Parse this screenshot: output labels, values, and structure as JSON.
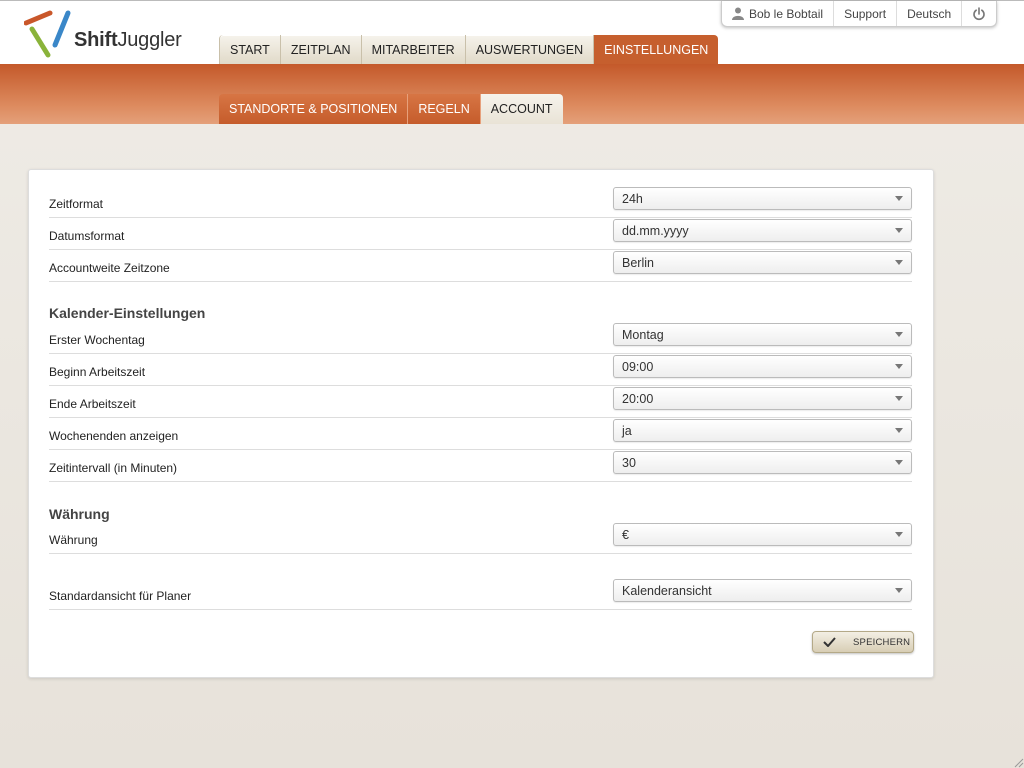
{
  "brand": {
    "name_bold": "Shift",
    "name_light": "Juggler"
  },
  "user_menu": {
    "user_name": "Bob le Bobtail",
    "support": "Support",
    "language": "Deutsch",
    "icons": [
      "user-icon",
      "power-icon"
    ]
  },
  "main_nav": {
    "tabs": [
      {
        "label": "START"
      },
      {
        "label": "ZEITPLAN"
      },
      {
        "label": "MITARBEITER"
      },
      {
        "label": "AUSWERTUNGEN"
      },
      {
        "label": "EINSTELLUNGEN"
      }
    ],
    "active": "EINSTELLUNGEN"
  },
  "sub_nav": {
    "tabs": [
      {
        "label": "STANDORTE & POSITIONEN"
      },
      {
        "label": "REGELN"
      },
      {
        "label": "ACCOUNT"
      }
    ],
    "active": "ACCOUNT"
  },
  "settings": {
    "general": [
      {
        "label": "Zeitformat",
        "value": "24h"
      },
      {
        "label": "Datumsformat",
        "value": "dd.mm.yyyy"
      },
      {
        "label": "Accountweite Zeitzone",
        "value": "Berlin"
      }
    ],
    "calendar_title": "Kalender-Einstellungen",
    "calendar": [
      {
        "label": "Erster Wochentag",
        "value": "Montag"
      },
      {
        "label": "Beginn Arbeitszeit",
        "value": "09:00"
      },
      {
        "label": "Ende Arbeitszeit",
        "value": "20:00"
      },
      {
        "label": "Wochenenden anzeigen",
        "value": "ja"
      },
      {
        "label": "Zeitintervall (in Minuten)",
        "value": "30"
      }
    ],
    "currency_title": "Währung",
    "currency": [
      {
        "label": "Währung",
        "value": "€"
      }
    ],
    "planner": [
      {
        "label": "Standardansicht für Planer",
        "value": "Kalenderansicht"
      }
    ],
    "save_label": "SPEICHERN"
  },
  "colors": {
    "accent": "#c65f2e",
    "tab_bg": "#e9e3d3",
    "page_bg": "#ece8e1"
  }
}
